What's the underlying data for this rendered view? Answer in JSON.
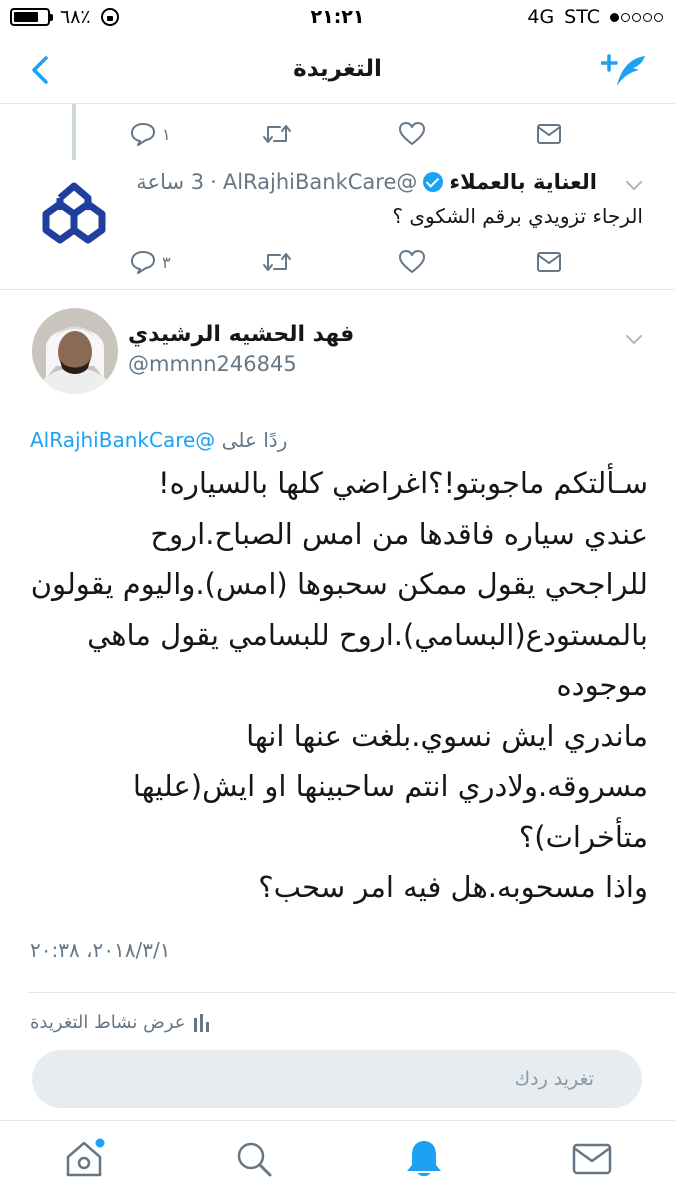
{
  "status_bar": {
    "battery": "٦٨٪",
    "time": "٢١:٢١",
    "network": "4G",
    "carrier": "STC",
    "battery_level": 0.68
  },
  "nav": {
    "title": "التغريدة"
  },
  "prev_actions": {
    "reply_count": "١"
  },
  "reply_tweet": {
    "name": "العناية بالعملاء",
    "handle": "@AlRajhiBankCare",
    "time": "3 ساعة",
    "separator": "·",
    "text": "الرجاء تزويدي برقم الشكوى ؟",
    "reply_count": "٣"
  },
  "main_tweet": {
    "name": "فهد الحشيه الرشيدي",
    "handle": "@mmnn246845",
    "replying_label": "ردًا على",
    "replying_handle": "@AlRajhiBankCare",
    "lines": [
      "سـألتكم ماجوبتو!؟اغراضي كلها بالسياره!",
      "عندي سياره فاقدها من امس الصباح.اروح",
      "للراجحي يقول ممكن سحبوها (امس).واليوم يقولون",
      "بالمستودع(البسامي).اروح للبسامي يقول ماهي",
      "موجوده",
      "ماندري ايش نسوي.بلغت عنها انها",
      "مسروقه.ولادري انتم ساحبينها او ايش(عليها",
      "متأخرات)؟",
      "واذا مسحوبه.هل فيه امر سحب؟"
    ],
    "date": "٢٠١٨/٣/١، ٢٠:٣٨"
  },
  "activity": {
    "label": "عرض نشاط التغريدة"
  },
  "reply_box": {
    "placeholder": "تغريد ردك"
  },
  "colors": {
    "accent": "#1da1f2",
    "muted": "#657786",
    "bank_logo": "#1f3e9e"
  }
}
